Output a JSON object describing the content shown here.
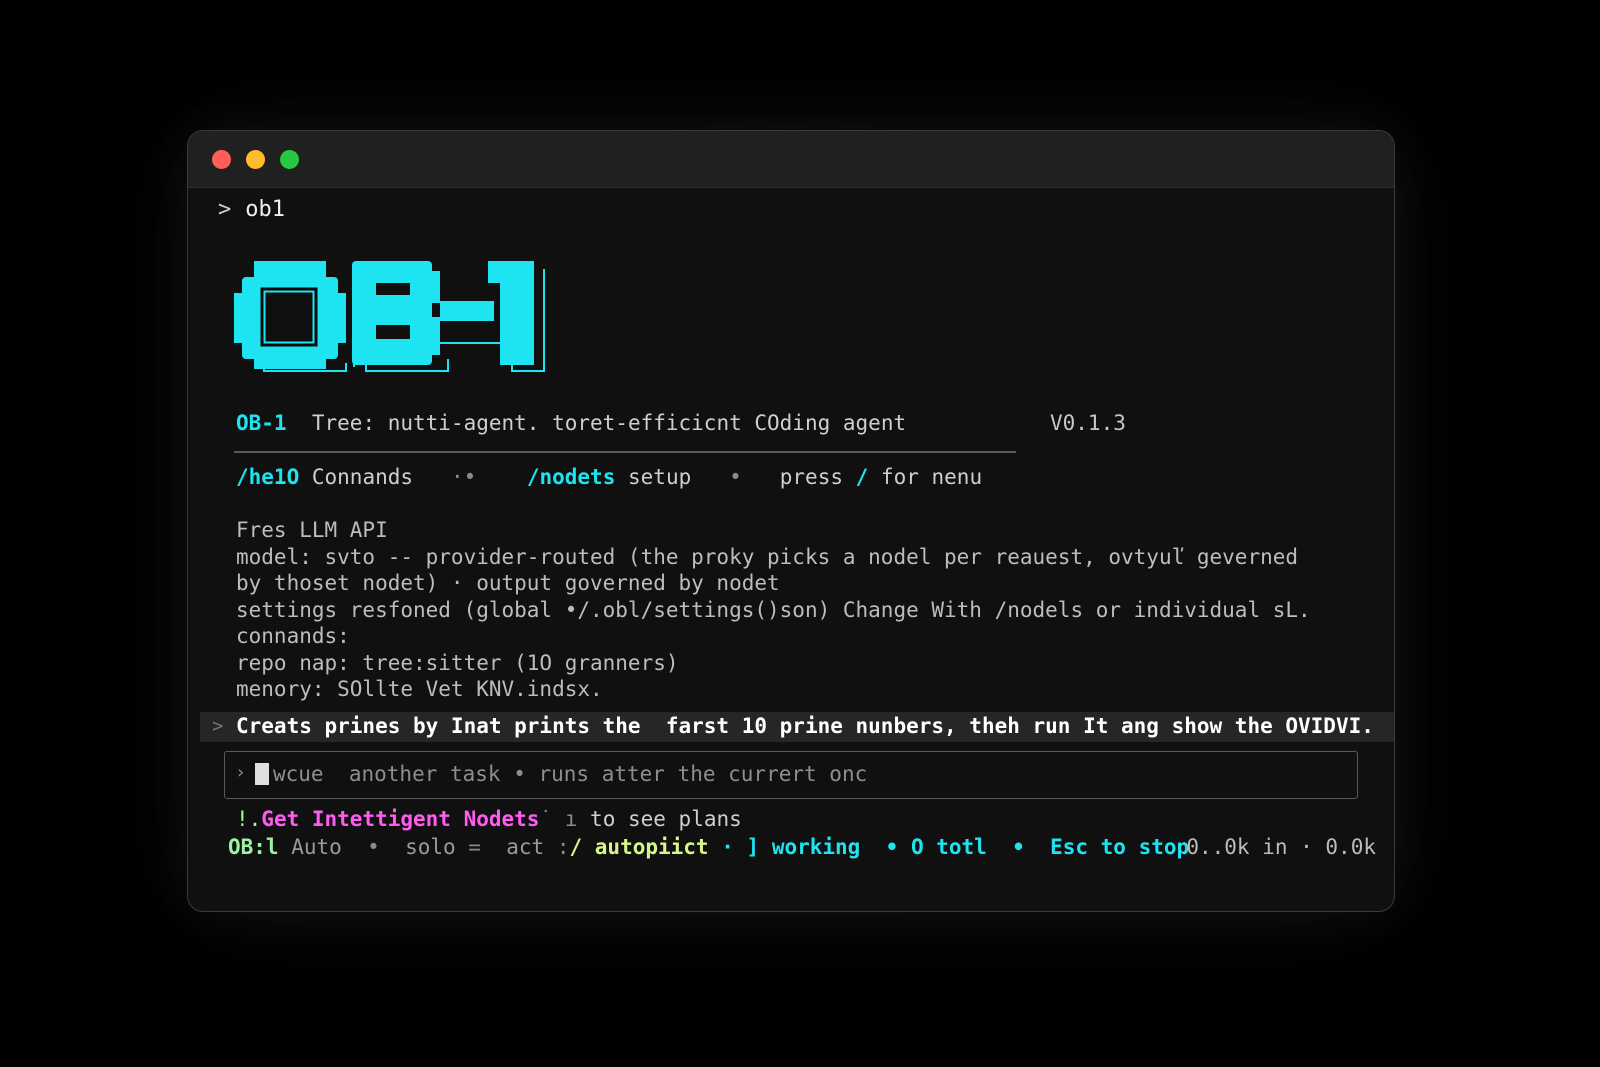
{
  "prompt": {
    "symbol": ">",
    "command": "ob1"
  },
  "logo": {
    "text": "OB-1",
    "color": "#1ee3f0"
  },
  "header": {
    "name": "OB-1",
    "tagline": "Tree: nutti-agent. toret-efficicnt COding agent",
    "version": "V0.1.3"
  },
  "help": {
    "help_cmd": "/he1O",
    "help_label": "Connands",
    "sep1": "·•",
    "models_cmd": "/nodets",
    "models_label": "setup",
    "sep2": "•",
    "press": "press",
    "slash": "/",
    "menu_label": "for nenu"
  },
  "info_lines": [
    "Fres LLM API",
    "model: svto -- provider-routed (the proky picks a nodel per reauest, ovtyuľ geverned",
    "by thoset nodet) · output governed by nodet",
    "settings resfoned (global •/.obl/settings()son) Change With /nodels or individual sL.",
    "connands:",
    "repo nap: tree:sitter (1O granners)",
    "menory: SOllte Vet KNV.indsx."
  ],
  "task": {
    "symbol": ">",
    "text": "Creats prines by Inat prints the  farst 10 prine nunbers, theh run It ang show the OVIDVI."
  },
  "input": {
    "symbol": "›",
    "placeholder": "wcue  another task • runs atter the currert onc"
  },
  "promo": {
    "prefix": "!.",
    "link": "Get Intettigent Nodets",
    "suffix": "˙ ı",
    "tail": "to see plans"
  },
  "status": {
    "brand": "OB:l",
    "mode_auto": "Auto",
    "sep_a": "•",
    "mode_solo": "solo",
    "sep_b": "=",
    "mode_act": "act",
    "sep_c": ":",
    "autopilot": "/ autopiict",
    "sep_d": "· ]",
    "working": "working",
    "sep_e": "•",
    "total": "O totl",
    "sep_f": "•",
    "esc": "Esc to stop",
    "tokens": "0..0k in · 0.0k"
  },
  "colors": {
    "accent_cyan": "#1ee3f0",
    "accent_magenta": "#ff5cf0",
    "accent_green": "#9df0a4",
    "traffic_red": "#ff5f57",
    "traffic_yellow": "#febc2e",
    "traffic_green": "#28c840"
  }
}
